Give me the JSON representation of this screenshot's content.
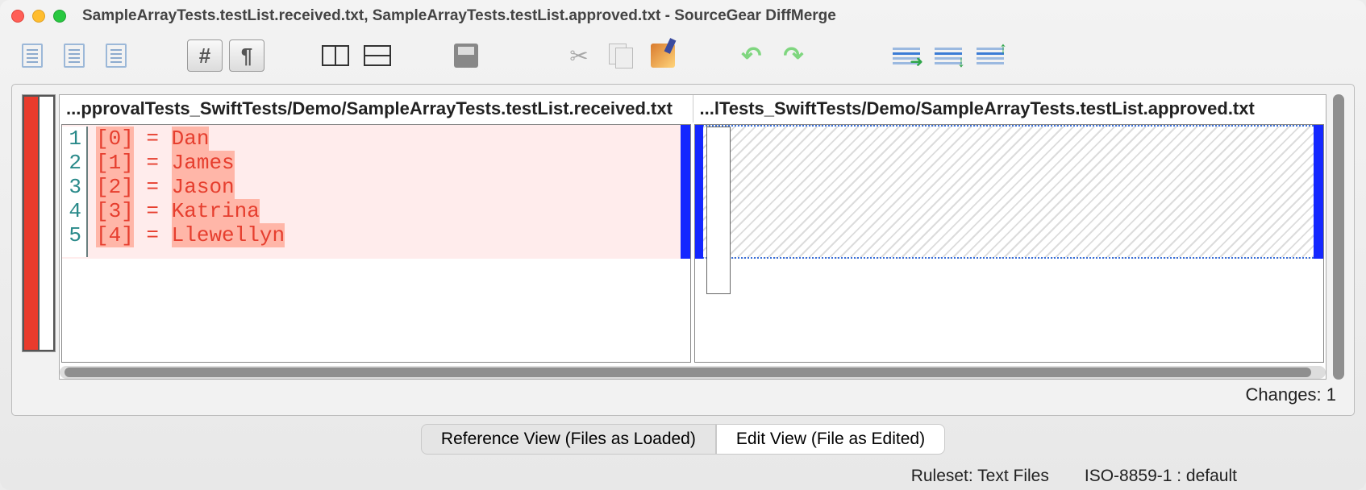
{
  "title": "SampleArrayTests.testList.received.txt, SampleArrayTests.testList.approved.txt - SourceGear DiffMerge",
  "headers": {
    "left": "...pprovalTests_SwiftTests/Demo/SampleArrayTests.testList.received.txt",
    "right": "...lTests_SwiftTests/Demo/SampleArrayTests.testList.approved.txt"
  },
  "lines": [
    {
      "num": "1",
      "idx": "[0]",
      "eq": "=",
      "name": "Dan"
    },
    {
      "num": "2",
      "idx": "[1]",
      "eq": "=",
      "name": "James"
    },
    {
      "num": "3",
      "idx": "[2]",
      "eq": "=",
      "name": "Jason"
    },
    {
      "num": "4",
      "idx": "[3]",
      "eq": "=",
      "name": "Katrina"
    },
    {
      "num": "5",
      "idx": "[4]",
      "eq": "=",
      "name": "Llewellyn"
    }
  ],
  "changes": "Changes: 1",
  "view": {
    "ref": "Reference View (Files as Loaded)",
    "edit": "Edit View (File as Edited)"
  },
  "status": {
    "ruleset": "Ruleset: Text Files",
    "encoding": "ISO-8859-1 : default"
  }
}
